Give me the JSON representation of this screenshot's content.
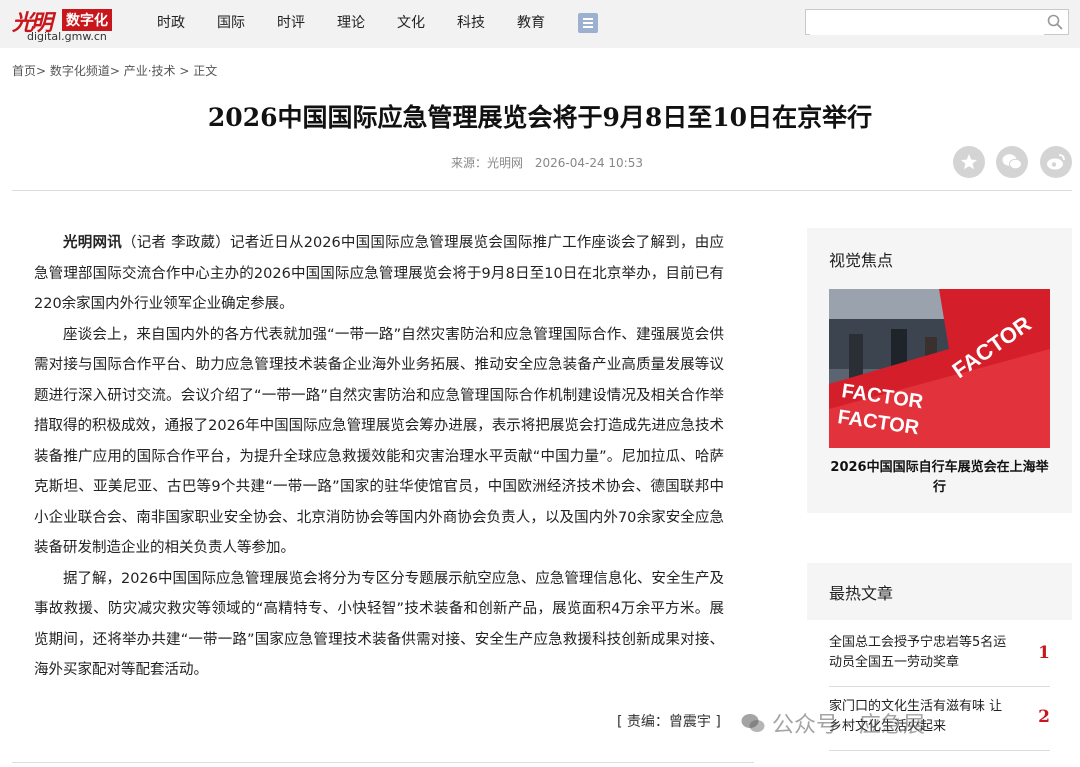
{
  "header": {
    "logo_mark": "光明",
    "logo_text": "数字化",
    "logo_sub": "digital.gmw.cn",
    "nav": [
      "时政",
      "国际",
      "时评",
      "理论",
      "文化",
      "科技",
      "教育"
    ],
    "search": {
      "value": "",
      "placeholder": ""
    }
  },
  "breadcrumb": "首页> 数字化频道> 产业·技术 > 正文",
  "article": {
    "title": "2026中国国际应急管理展览会将于9月8日至10日在京举行",
    "source": "来源：光明网",
    "date": "2026-04-24 10:53",
    "lead": "光明网讯",
    "p1_rest": "（记者 李政葳）记者近日从2026中国国际应急管理展览会国际推广工作座谈会了解到，由应急管理部国际交流合作中心主办的2026中国国际应急管理展览会将于9月8日至10日在北京举办，目前已有220余家国内外行业领军企业确定参展。",
    "p2": "座谈会上，来自国内外的各方代表就加强“一带一路”自然灾害防治和应急管理国际合作、建强展览会供需对接与国际合作平台、助力应急管理技术装备企业海外业务拓展、推动安全应急装备产业高质量发展等议题进行深入研讨交流。会议介绍了“一带一路”自然灾害防治和应急管理国际合作机制建设情况及相关合作举措取得的积极成效，通报了2026年中国国际应急管理展览会筹办进展，表示将把展览会打造成先进应急技术装备推广应用的国际合作平台，为提升全球应急救援效能和灾害治理水平贡献“中国力量”。尼加拉瓜、哈萨克斯坦、亚美尼亚、古巴等9个共建“一带一路”国家的驻华使馆官员，中国欧洲经济技术协会、德国联邦中小企业联合会、南非国家职业安全协会、北京消防协会等国内外商协会负责人，以及国内外70余家安全应急装备研发制造企业的相关负责人等参加。",
    "p3": "据了解，2026中国国际应急管理展览会将分为专区分专题展示航空应急、应急管理信息化、安全生产及事故救援、防灾减灾救灾等领域的“高精特专、小快轻智”技术装备和创新产品，展览面积4万余平方米。展览期间，还将举办共建“一带一路”国家应急管理技术装备供需对接、安全生产应急救援科技创新成果对接、海外买家配对等配套活动。",
    "editor": "[ 责编：曾震宇 ]"
  },
  "sidebar": {
    "focus_title": "视觉焦点",
    "focus_caption": "2026中国国际自行车展览会在上海举行",
    "photo_text": "FACTOR",
    "hot_title": "最热文章",
    "hot": [
      {
        "title": "全国总工会授予宁忠岩等5名运动员全国五一劳动奖章",
        "rank": "1"
      },
      {
        "title": "家门口的文化生活有滋有味 让乡村文化生活火起来",
        "rank": "2"
      }
    ]
  },
  "watermark": "公众号 · 应急展",
  "colors": {
    "brand_red": "#c8161d",
    "nav_bg": "#f2f2f2",
    "sidebar_bg": "#f5f5f5"
  }
}
